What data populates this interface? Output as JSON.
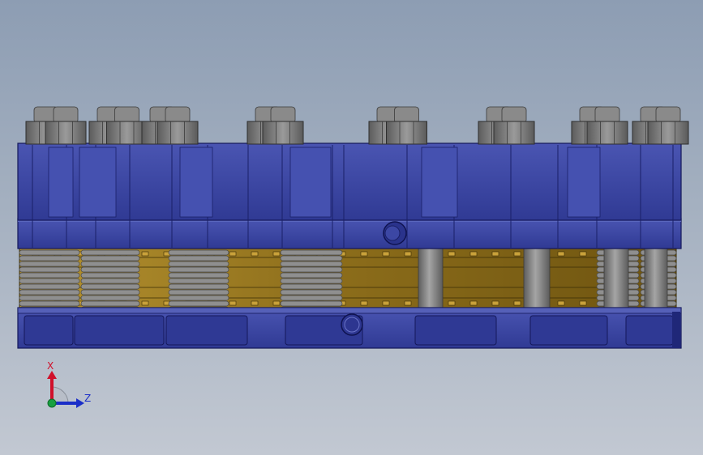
{
  "viewport": {
    "background_top": "#8d9db3",
    "background_bottom": "#c2c8d2"
  },
  "model": {
    "plate_color": "#3b45a0",
    "plate_dark": "#242c78",
    "plate_light": "#5560b8",
    "core_color": "#9a7a22",
    "bolt_color": "#7e7e7e",
    "spring_color": "#8f8f8f"
  },
  "triad": {
    "x_label": "X",
    "z_label": "Z",
    "x_color": "#d0102a",
    "z_color": "#1a2ec8",
    "origin_color": "#18a040"
  }
}
